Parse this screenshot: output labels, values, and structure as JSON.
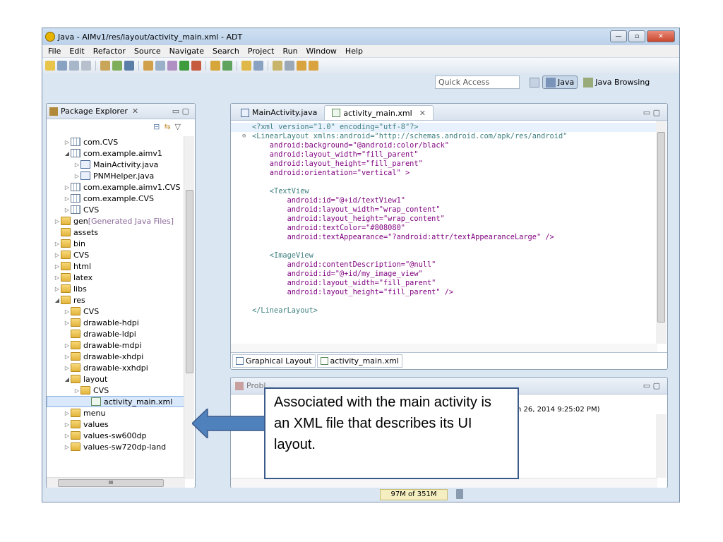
{
  "window": {
    "title": "Java - AIMv1/res/layout/activity_main.xml - ADT",
    "controls": [
      "—",
      "▫",
      "✕"
    ]
  },
  "menubar": [
    "File",
    "Edit",
    "Refactor",
    "Source",
    "Navigate",
    "Search",
    "Project",
    "Run",
    "Window",
    "Help"
  ],
  "quick_access": {
    "placeholder": "Quick Access"
  },
  "perspectives": [
    {
      "label": "Java",
      "active": true
    },
    {
      "label": "Java Browsing",
      "active": false
    }
  ],
  "package_explorer": {
    "title": "Package Explorer",
    "close": "✕",
    "tree": [
      {
        "label": "com.CVS",
        "level": 2,
        "icon": "package",
        "arrow": "▷"
      },
      {
        "label": "com.example.aimv1",
        "level": 2,
        "icon": "package-open",
        "arrow": "◢"
      },
      {
        "label": "MainActivity.java",
        "level": 3,
        "icon": "java",
        "arrow": "▷"
      },
      {
        "label": "PNMHelper.java",
        "level": 3,
        "icon": "java",
        "arrow": "▷"
      },
      {
        "label": "com.example.aimv1.CVS",
        "level": 2,
        "icon": "package",
        "arrow": "▷"
      },
      {
        "label": "com.example.CVS",
        "level": 2,
        "icon": "package",
        "arrow": "▷"
      },
      {
        "label": "CVS",
        "level": 2,
        "icon": "package",
        "arrow": "▷"
      },
      {
        "label": "gen",
        "suffix": " [Generated Java Files]",
        "level": 1,
        "icon": "folder",
        "arrow": "▷"
      },
      {
        "label": "assets",
        "level": 1,
        "icon": "folder",
        "arrow": ""
      },
      {
        "label": "bin",
        "level": 1,
        "icon": "folder",
        "arrow": "▷"
      },
      {
        "label": "CVS",
        "level": 1,
        "icon": "folder",
        "arrow": "▷"
      },
      {
        "label": "html",
        "level": 1,
        "icon": "folder",
        "arrow": "▷"
      },
      {
        "label": "latex",
        "level": 1,
        "icon": "folder",
        "arrow": "▷"
      },
      {
        "label": "libs",
        "level": 1,
        "icon": "folder",
        "arrow": "▷"
      },
      {
        "label": "res",
        "level": 1,
        "icon": "folder",
        "arrow": "◢"
      },
      {
        "label": "CVS",
        "level": 2,
        "icon": "folder",
        "arrow": "▷"
      },
      {
        "label": "drawable-hdpi",
        "level": 2,
        "icon": "folder",
        "arrow": "▷"
      },
      {
        "label": "drawable-ldpi",
        "level": 2,
        "icon": "folder",
        "arrow": ""
      },
      {
        "label": "drawable-mdpi",
        "level": 2,
        "icon": "folder",
        "arrow": "▷"
      },
      {
        "label": "drawable-xhdpi",
        "level": 2,
        "icon": "folder",
        "arrow": "▷"
      },
      {
        "label": "drawable-xxhdpi",
        "level": 2,
        "icon": "folder",
        "arrow": "▷"
      },
      {
        "label": "layout",
        "level": 2,
        "icon": "folder",
        "arrow": "◢"
      },
      {
        "label": "CVS",
        "level": 3,
        "icon": "folder",
        "arrow": "▷"
      },
      {
        "label": "activity_main.xml",
        "level": 4,
        "icon": "xml",
        "arrow": "",
        "selected": true
      },
      {
        "label": "menu",
        "level": 2,
        "icon": "folder",
        "arrow": "▷"
      },
      {
        "label": "values",
        "level": 2,
        "icon": "folder",
        "arrow": "▷"
      },
      {
        "label": "values-sw600dp",
        "level": 2,
        "icon": "folder",
        "arrow": "▷"
      },
      {
        "label": "values-sw720dp-land",
        "level": 2,
        "icon": "folder",
        "arrow": "▷"
      }
    ],
    "hscroll_label": "III"
  },
  "editor": {
    "tabs": [
      {
        "label": "MainActivity.java",
        "active": false
      },
      {
        "label": "activity_main.xml",
        "active": true,
        "close": "✕"
      }
    ],
    "code_lines": [
      "<?xml version=\"1.0\" encoding=\"utf-8\"?>",
      "<LinearLayout xmlns:android=\"http://schemas.android.com/apk/res/android\"",
      "    android:background=\"@android:color/black\"",
      "    android:layout_width=\"fill_parent\"",
      "    android:layout_height=\"fill_parent\"",
      "    android:orientation=\"vertical\" >",
      "",
      "    <TextView",
      "        android:id=\"@+id/textView1\"",
      "        android:layout_width=\"wrap_content\"",
      "        android:layout_height=\"wrap_content\"",
      "        android:textColor=\"#808080\"",
      "        android:textAppearance=\"?android:attr/textAppearanceLarge\" />",
      "",
      "    <ImageView",
      "        android:contentDescription=\"@null\"",
      "        android:id=\"@+id/my_image_view\"",
      "        android:layout_width=\"fill_parent\"",
      "        android:layout_height=\"fill_parent\" />",
      "",
      "</LinearLayout>"
    ],
    "bottom_tabs": [
      "Graphical Layout",
      "activity_main.xml"
    ]
  },
  "console": {
    "tabs_visible": "Probl...",
    "timestamp": "(Jan 26, 2014 9:25:02 PM)"
  },
  "status": {
    "heap": "97M of 351M"
  },
  "callout": {
    "text": "Associated with the main activity is an XML file that describes its UI layout."
  },
  "colors": {
    "window_bg": "#dbe6f3",
    "callout_border": "#3a5a89",
    "arrow_fill": "#4f81bd"
  }
}
